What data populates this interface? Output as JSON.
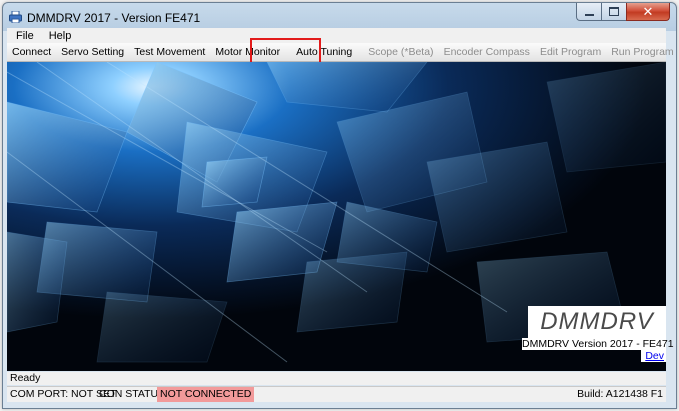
{
  "window": {
    "title": "DMMDRV 2017 - Version FE471",
    "icon": "app-printer-icon",
    "controls": {
      "minimize": "minimize-icon",
      "maximize": "maximize-icon",
      "close": "✕"
    }
  },
  "menu": [
    "File",
    "Help"
  ],
  "toolbar": {
    "items": [
      {
        "label": "Connect",
        "enabled": true
      },
      {
        "label": "Servo Setting",
        "enabled": true
      },
      {
        "label": "Test Movement",
        "enabled": true
      },
      {
        "label": "Motor Monitor",
        "enabled": true
      },
      {
        "label": "Auto Tuning",
        "enabled": true,
        "highlighted": true
      },
      {
        "label": "Scope (*Beta)",
        "enabled": false
      },
      {
        "label": "Encoder Compass",
        "enabled": false
      },
      {
        "label": "Edit Program",
        "enabled": false
      },
      {
        "label": "Run Program",
        "enabled": false
      }
    ],
    "highlight_color": "#e21b1b"
  },
  "splash": {
    "logo": "DMMDRV",
    "version": "DMMDRV Version 2017 - FE471",
    "link": "Dev"
  },
  "status": {
    "ready": "Ready",
    "com_port": "COM PORT: NOT SET",
    "con_status_label": "CON STATUS:",
    "con_status_value": "NOT CONNECTED",
    "con_status_color": "#f29a9a",
    "build": "Build: A121438 F1"
  }
}
